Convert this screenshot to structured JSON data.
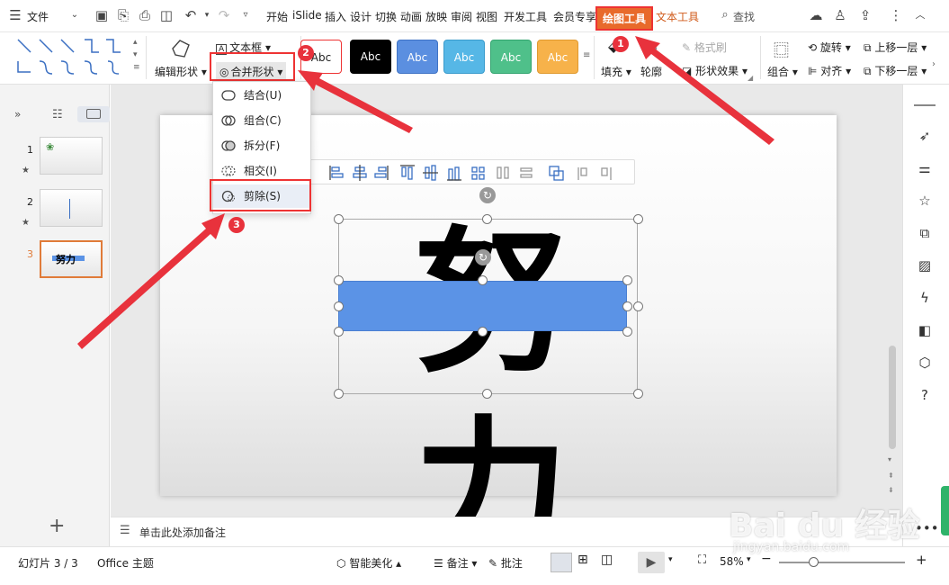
{
  "topbar": {
    "file_menu": "文件",
    "tabs": [
      "开始",
      "iSlide",
      "插入",
      "设计",
      "切换",
      "动画",
      "放映",
      "审阅",
      "视图",
      "开发工具",
      "会员专享",
      "绘图工具",
      "文本工具"
    ],
    "search": "查找"
  },
  "ribbon": {
    "edit_shape": "编辑形状",
    "text_box": "文本框",
    "merge_shapes": "合并形状",
    "style_sample": "Abc",
    "fill": "填充",
    "outline": "轮廓",
    "format_painter": "格式刷",
    "shape_effects": "形状效果",
    "group": "组合",
    "rotate": "旋转",
    "align": "对齐",
    "bring_forward": "上移一层",
    "send_backward": "下移一层"
  },
  "dropdown": {
    "items": [
      "结合(U)",
      "组合(C)",
      "拆分(F)",
      "相交(I)",
      "剪除(S)"
    ]
  },
  "badges": [
    "1",
    "2",
    "3"
  ],
  "slides": {
    "numbers": [
      "1",
      "2",
      "3"
    ],
    "thumb3_text": "努力"
  },
  "slide_content": {
    "big_text": "努力"
  },
  "notes": {
    "placeholder": "单击此处添加备注"
  },
  "status": {
    "slide_counter": "幻灯片 3 / 3",
    "theme": "Office 主题",
    "smart_beautify": "智能美化",
    "notes": "备注",
    "comments": "批注",
    "zoom": "58%"
  },
  "watermark": {
    "logo": "Bai du 经验",
    "url": "jingyan.baidu.com"
  },
  "colors": {
    "accent_orange": "#e86a2b",
    "annotation_red": "#e8323c",
    "shape_blue": "#5b93e6"
  }
}
